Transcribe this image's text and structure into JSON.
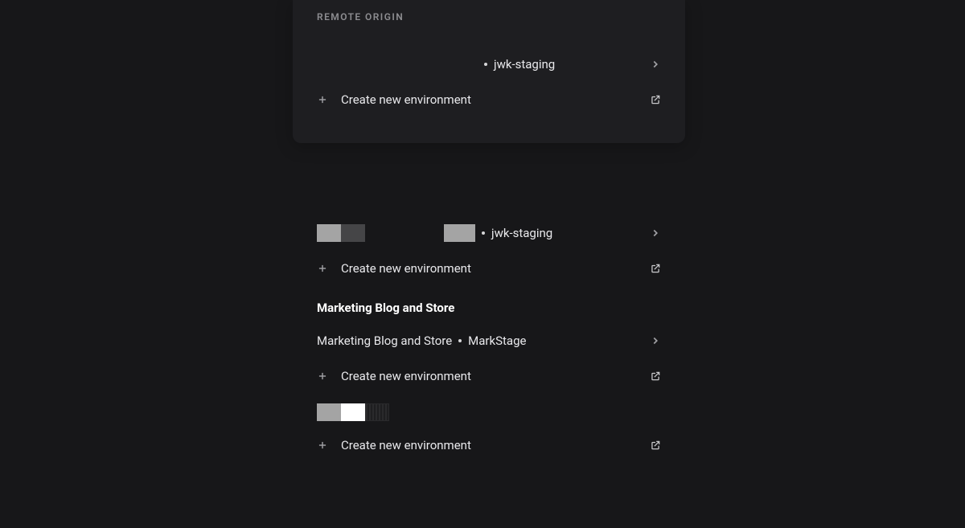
{
  "panel": {
    "section_label": "REMOTE ORIGIN",
    "env1_name": "jwk-staging",
    "create_label": "Create new environment"
  },
  "lower": {
    "env2_name": "jwk-staging",
    "create_label": "Create new environment",
    "project_title": "Marketing Blog and Store",
    "project_row_name": "Marketing Blog and Store",
    "project_row_env": "MarkStage"
  }
}
